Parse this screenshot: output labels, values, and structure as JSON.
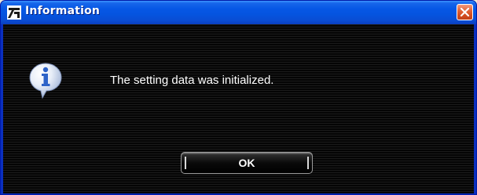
{
  "window": {
    "title": "Information",
    "app_icon": "app-logo-icon",
    "close_icon": "close-icon"
  },
  "dialog": {
    "icon": "info-icon",
    "message": "The setting data was initialized.",
    "ok_label": "OK"
  },
  "colors": {
    "titlebar": "#0657e5",
    "close_button": "#d34c1f",
    "background": "#0c0c0c",
    "text": "#ffffff"
  }
}
